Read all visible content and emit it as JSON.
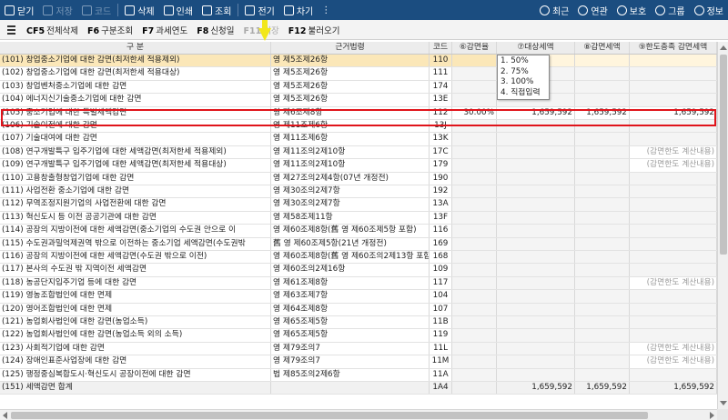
{
  "toolbar": {
    "left": [
      {
        "name": "close-button",
        "icon": "close-icon",
        "label": "닫기",
        "enabled": true
      },
      {
        "name": "save-button",
        "icon": "save-icon",
        "label": "저장",
        "enabled": false
      },
      {
        "name": "code-button",
        "icon": "code-icon",
        "label": "코드",
        "enabled": false
      },
      {
        "name": "delete-button",
        "icon": "trash-icon",
        "label": "삭제",
        "enabled": true
      },
      {
        "name": "print-button",
        "icon": "printer-icon",
        "label": "인쇄",
        "enabled": true
      },
      {
        "name": "search-button",
        "icon": "search-icon",
        "label": "조회",
        "enabled": true
      },
      {
        "name": "calendar-button",
        "icon": "calendar-icon",
        "label": "전기",
        "enabled": true
      },
      {
        "name": "next-button",
        "icon": "next-icon",
        "label": "차기",
        "enabled": true
      }
    ],
    "more": "⋮",
    "right": [
      {
        "name": "recent-button",
        "icon": "recent-icon",
        "label": "최근"
      },
      {
        "name": "link-button",
        "icon": "link-icon",
        "label": "연관"
      },
      {
        "name": "protect-button",
        "icon": "shield-icon",
        "label": "보호"
      },
      {
        "name": "group-button",
        "icon": "group-icon",
        "label": "그룹"
      },
      {
        "name": "info-button",
        "icon": "info-icon",
        "label": "정보"
      }
    ]
  },
  "fkeys": [
    {
      "key": "CF5",
      "label": "전체삭제",
      "enabled": true
    },
    {
      "key": "F6",
      "label": "구분조회",
      "enabled": true
    },
    {
      "key": "F7",
      "label": "과세연도",
      "enabled": true
    },
    {
      "key": "F8",
      "label": "신청일",
      "enabled": true
    },
    {
      "key": "F11",
      "label": "저장",
      "enabled": false
    },
    {
      "key": "F12",
      "label": "불러오기",
      "enabled": true
    }
  ],
  "header": [
    "구 분",
    "근거법령",
    "코드",
    "⑥감면율",
    "⑦대상세액",
    "⑧감면세액",
    "⑨한도충족 감면세액"
  ],
  "rows": [
    {
      "gubun": "(101) 창업중소기업에 대한 감면(최저한세 적용제외)",
      "law": "영 제5조제26항",
      "code": "110",
      "rate": "",
      "target": "",
      "reduce": "",
      "limit": "",
      "highlight": true
    },
    {
      "gubun": "(102) 창업중소기업에 대한 감면(최저한세 적용대상)",
      "law": "영 제5조제26항",
      "code": "111",
      "rate": "",
      "target": "",
      "reduce": "",
      "limit": ""
    },
    {
      "gubun": "(103) 창업벤처중소기업에 대한 감면",
      "law": "영 제5조제26항",
      "code": "174",
      "rate": "",
      "target": "",
      "reduce": "",
      "limit": ""
    },
    {
      "gubun": "(104) 에너지신기술중소기업에 대한 감면",
      "law": "영 제5조제26항",
      "code": "13E",
      "rate": "",
      "target": "",
      "reduce": "",
      "limit": ""
    },
    {
      "gubun": "(105) 중소기업에 대한 특별세액감면",
      "law": "영 제6조제8항",
      "code": "112",
      "rate": "30.00%",
      "target": "1,659,592",
      "reduce": "1,659,592",
      "limit": "1,659,592"
    },
    {
      "gubun": "(106) 기술이전에 대한 감면",
      "law": "영 제11조제6항",
      "code": "13J",
      "rate": "",
      "target": "",
      "reduce": "",
      "limit": ""
    },
    {
      "gubun": "(107) 기술대여에 대한 감면",
      "law": "영 제11조제6항",
      "code": "13K",
      "rate": "",
      "target": "",
      "reduce": "",
      "limit": ""
    },
    {
      "gubun": "(108) 연구개발특구 입주기업에 대한 세액감면(최저한세 적용제외)",
      "law": "영 제11조의2제10항",
      "code": "17C",
      "rate": "",
      "target": "",
      "reduce": "",
      "limit": "(감면한도 계산내용)"
    },
    {
      "gubun": "(109) 연구개발특구 입주기업에 대한 세액감면(최저한세 적용대상)",
      "law": "영 제11조의2제10항",
      "code": "179",
      "rate": "",
      "target": "",
      "reduce": "",
      "limit": "(감면한도 계산내용)"
    },
    {
      "gubun": "(110) 고용창출형창업기업에 대한 감면",
      "law": "영 제27조의2제4항(07년 개정전)",
      "code": "190",
      "rate": "",
      "target": "",
      "reduce": "",
      "limit": ""
    },
    {
      "gubun": "(111) 사업전환 중소기업에 대한 감면",
      "law": "영 제30조의2제7항",
      "code": "192",
      "rate": "",
      "target": "",
      "reduce": "",
      "limit": ""
    },
    {
      "gubun": "(112) 무역조정지원기업의 사업전환에 대한 감면",
      "law": "영 제30조의2제7항",
      "code": "13A",
      "rate": "",
      "target": "",
      "reduce": "",
      "limit": ""
    },
    {
      "gubun": "(113) 혁신도시 등 이전 공공기관에 대한 감면",
      "law": "영 제58조제11항",
      "code": "13F",
      "rate": "",
      "target": "",
      "reduce": "",
      "limit": ""
    },
    {
      "gubun": "(114) 공장의 지방이전에 대한 세액감면(중소기업의 수도권 안으로 이",
      "law": "영 제60조제8항(舊 영 제60조제5항 포함)",
      "code": "116",
      "rate": "",
      "target": "",
      "reduce": "",
      "limit": ""
    },
    {
      "gubun": "(115) 수도권과밀억제권역 밖으로 이전하는 중소기업 세액감면(수도권밖",
      "law": "舊 영 제60조제5항(21년 개정전)",
      "code": "169",
      "rate": "",
      "target": "",
      "reduce": "",
      "limit": ""
    },
    {
      "gubun": "(116) 공장의 지방이전에 대한 세액감면(수도권 밖으로 이전)",
      "law": "영 제60조제8항(舊 영 제60조의2제13항 포함)",
      "code": "168",
      "rate": "",
      "target": "",
      "reduce": "",
      "limit": ""
    },
    {
      "gubun": "(117) 본사의 수도권 밖 지역이전 세액감면",
      "law": "영 제60조의2제16항",
      "code": "109",
      "rate": "",
      "target": "",
      "reduce": "",
      "limit": ""
    },
    {
      "gubun": "(118) 농공단지입주기업 등에 대한 감면",
      "law": "영 제61조제8항",
      "code": "117",
      "rate": "",
      "target": "",
      "reduce": "",
      "limit": "(감면한도 계산내용)"
    },
    {
      "gubun": "(119) 영농조합법인에 대한 면제",
      "law": "영 제63조제7항",
      "code": "104",
      "rate": "",
      "target": "",
      "reduce": "",
      "limit": ""
    },
    {
      "gubun": "(120) 영어조합법인에 대한 면제",
      "law": "영 제64조제8항",
      "code": "107",
      "rate": "",
      "target": "",
      "reduce": "",
      "limit": ""
    },
    {
      "gubun": "(121) 농업회사법인에 대한 감면(농업소득)",
      "law": "영 제65조제5항",
      "code": "11B",
      "rate": "",
      "target": "",
      "reduce": "",
      "limit": ""
    },
    {
      "gubun": "(122) 농업회사법인에 대한 감면(농업소득 외의 소득)",
      "law": "영 제65조제5항",
      "code": "119",
      "rate": "",
      "target": "",
      "reduce": "",
      "limit": ""
    },
    {
      "gubun": "(123) 사회적기업에 대한 감면",
      "law": "영 제79조의7",
      "code": "11L",
      "rate": "",
      "target": "",
      "reduce": "",
      "limit": "(감면한도 계산내용)"
    },
    {
      "gubun": "(124) 장애인표준사업장에 대한 감면",
      "law": "영 제79조의7",
      "code": "11M",
      "rate": "",
      "target": "",
      "reduce": "",
      "limit": "(감면한도 계산내용)"
    },
    {
      "gubun": "(125) 행정중심복합도시·혁신도시 공장이전에 대한 감면",
      "law": "법 제85조의2제6항",
      "code": "11A",
      "rate": "",
      "target": "",
      "reduce": "",
      "limit": ""
    },
    {
      "gubun": "(151) 세액감면 합계",
      "law": "",
      "code": "1A4",
      "rate": "",
      "target": "1,659,592",
      "reduce": "1,659,592",
      "limit": "1,659,592",
      "total": true
    }
  ],
  "dropdown": {
    "options": [
      "1. 50%",
      "2. 75%",
      "3. 100%",
      "4. 직접입력"
    ]
  }
}
